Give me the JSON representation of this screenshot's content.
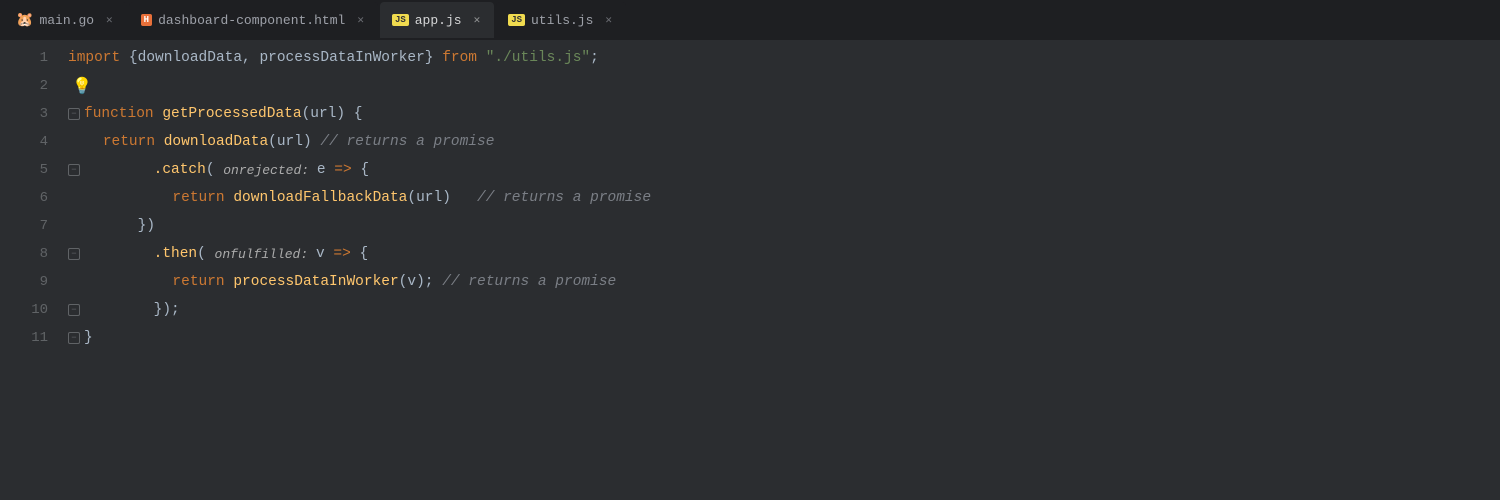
{
  "tabs": [
    {
      "id": "main-go",
      "label": "main.go",
      "icon_type": "go",
      "icon_text": "🐹",
      "active": false,
      "closable": true
    },
    {
      "id": "dashboard-component",
      "label": "dashboard-component.html",
      "icon_type": "html",
      "icon_text": "H",
      "active": false,
      "closable": true
    },
    {
      "id": "app-js",
      "label": "app.js",
      "icon_type": "js",
      "icon_text": "JS",
      "active": true,
      "closable": true
    },
    {
      "id": "utils-js",
      "label": "utils.js",
      "icon_type": "js",
      "icon_text": "JS",
      "active": false,
      "closable": true
    }
  ],
  "close_label": "✕",
  "code": {
    "lines": [
      {
        "number": "1",
        "fold": false,
        "content": "import {downloadData, processDataInWorker} from \"./utils.js\";"
      },
      {
        "number": "2",
        "fold": false,
        "has_bulb": true,
        "content": ""
      },
      {
        "number": "3",
        "fold": true,
        "fold_open": true,
        "content": "function getProcessedData(url) {"
      },
      {
        "number": "4",
        "fold": false,
        "content": "    return downloadData(url) // returns a promise"
      },
      {
        "number": "5",
        "fold": true,
        "fold_open": true,
        "content": "        .catch( onrejected: e => {"
      },
      {
        "number": "6",
        "fold": false,
        "content": "            return downloadFallbackData(url)   // returns a promise"
      },
      {
        "number": "7",
        "fold": false,
        "content": "        })"
      },
      {
        "number": "8",
        "fold": true,
        "fold_open": true,
        "content": "        .then( onfulfilled: v => {"
      },
      {
        "number": "9",
        "fold": false,
        "content": "            return processDataInWorker(v); // returns a promise"
      },
      {
        "number": "10",
        "fold": true,
        "fold_open": true,
        "content": "        });"
      },
      {
        "number": "11",
        "fold": true,
        "fold_open": true,
        "content": "}"
      }
    ]
  }
}
